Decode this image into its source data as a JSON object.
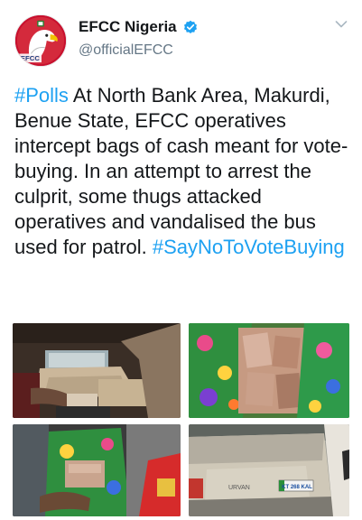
{
  "tweet": {
    "display_name": "EFCC Nigeria",
    "handle": "@officialEFCC",
    "avatar_label": "EFCC",
    "verified": true,
    "more_menu_icon": "chevron-down-icon",
    "text_segments": [
      {
        "text": "#Polls",
        "type": "hashtag"
      },
      {
        "text": " At North Bank Area, Makurdi, Benue State, EFCC operatives intercept bags of cash meant for vote-buying. In an attempt to arrest the culprit, some thugs attacked operatives and vandalised the bus used for patrol. ",
        "type": "text"
      },
      {
        "text": "#SayNoToVoteBuying",
        "type": "hashtag"
      }
    ],
    "media": {
      "photo3_text": "LIRVAN",
      "photo4_brand": "URVAN",
      "photo4_plate": "KT 268 KAL"
    }
  },
  "colors": {
    "link": "#1da1f2",
    "handle": "#657786",
    "verified": "#1da1f2",
    "avatar_bg": "#c8102e"
  }
}
